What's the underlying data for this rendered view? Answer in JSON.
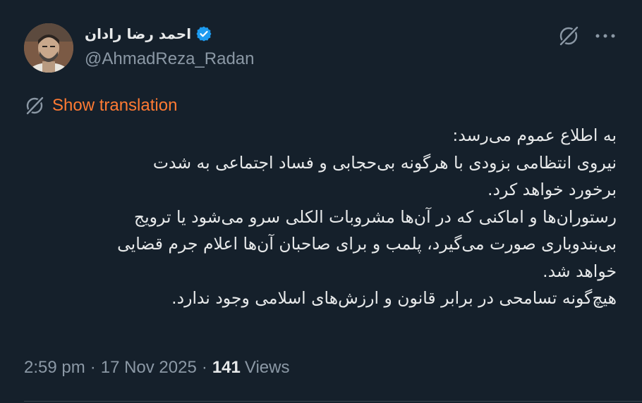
{
  "tweet": {
    "author": {
      "display_name": "احمد رضا رادان",
      "handle": "@AhmadReza_Radan",
      "verified_icon": "verified-badge-icon"
    },
    "actions": {
      "grok_icon": "grok-icon",
      "more_icon": "more-dots-icon"
    },
    "translation": {
      "label": "Show translation",
      "icon": "grok-icon",
      "color": "#ff7a33"
    },
    "body_lines": [
      "به اطلاع عموم می‌رسد:",
      "نیروی انتظامی بزودی با هرگونه بی‌حجابی و فساد اجتماعی به شدت",
      "برخورد خواهد کرد.",
      "رستوران‌ها و اماکنی که در آن‌ها مشروبات الکلی سرو می‌شود یا ترویج",
      "بی‌بندوباری صورت می‌گیرد، پلمب و برای صاحبان آن‌ها اعلام جرم قضایی",
      "خواهد شد.",
      "هیچ‌گونه تسامحی در برابر قانون و ارزش‌های اسلامی وجود ندارد."
    ],
    "meta": {
      "time": "2:59 pm",
      "separator": "·",
      "date": "17 Nov 2025",
      "views_count": "141",
      "views_label": "Views"
    }
  },
  "colors": {
    "background": "#15202b",
    "text_primary": "#e7e9ea",
    "text_secondary": "#8b98a5",
    "verified_blue": "#1d9bf0",
    "accent_orange": "#ff7a33"
  }
}
